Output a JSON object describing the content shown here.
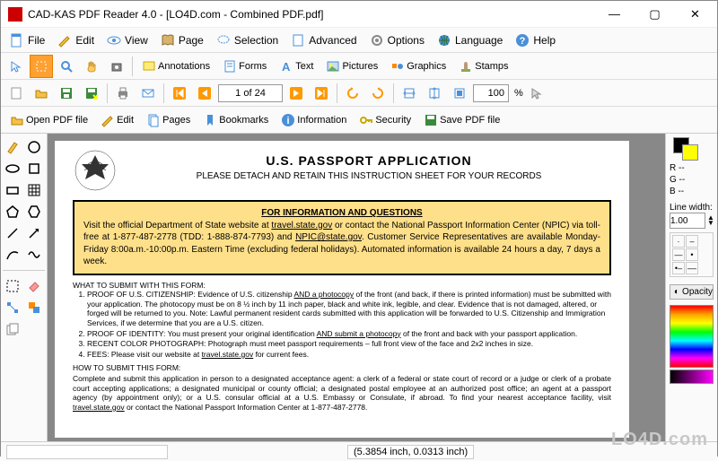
{
  "window": {
    "title": "CAD-KAS PDF Reader 4.0 - [LO4D.com - Combined PDF.pdf]",
    "min": "—",
    "max": "▢",
    "close": "✕"
  },
  "menu": {
    "file": "File",
    "edit": "Edit",
    "view": "View",
    "page": "Page",
    "selection": "Selection",
    "advanced": "Advanced",
    "options": "Options",
    "language": "Language",
    "help": "Help"
  },
  "tooltabs": {
    "annotations": "Annotations",
    "forms": "Forms",
    "text": "Text",
    "pictures": "Pictures",
    "graphics": "Graphics",
    "stamps": "Stamps"
  },
  "nav": {
    "page": "1 of 24",
    "zoom": "100",
    "pct": "%"
  },
  "actions": {
    "open": "Open PDF file",
    "edit": "Edit",
    "pages": "Pages",
    "bookmarks": "Bookmarks",
    "information": "Information",
    "security": "Security",
    "save": "Save PDF file"
  },
  "rightpanel": {
    "r": "R --",
    "g": "G --",
    "b": "B --",
    "linewidth_label": "Line width:",
    "linewidth": "1.00",
    "opacity": "Opacity"
  },
  "status": {
    "pos": "(5.3854 inch, 0.0313 inch)"
  },
  "watermark": "LO4D.com",
  "doc": {
    "h1": "U.S. PASSPORT APPLICATION",
    "h2": "PLEASE DETACH AND RETAIN THIS INSTRUCTION SHEET FOR YOUR RECORDS",
    "boxtitle": "FOR INFORMATION AND QUESTIONS",
    "boxtext1": "Visit the official Department of State website at ",
    "boxlink1": "travel.state.gov",
    "boxtext2": " or contact the National Passport Information Center (NPIC) via toll-free at 1-877-487-2778 (TDD: 1-888-874-7793) and ",
    "boxlink2": "NPIC@state.gov",
    "boxtext3": ". Customer Service Representatives are available Monday-Friday 8:00a.m.-10:00p.m. Eastern Time (excluding federal holidays). Automated information is available 24 hours a day, 7 days a week.",
    "s1title": "WHAT TO SUBMIT WITH THIS FORM:",
    "li1a": "PROOF OF U.S. CITIZENSHIP: Evidence of U.S. citizenship ",
    "li1u": "AND a photocopy",
    "li1b": " of the front (and back, if there is printed information) must be submitted with your application. The photocopy must be on 8 ½ inch by 11 inch paper, black and white ink, legible, and clear. Evidence that is not damaged, altered, or forged will be returned to you. Note: Lawful permanent resident cards submitted with this application will be forwarded to U.S. Citizenship and Immigration Services, if we determine that you are a U.S. citizen.",
    "li2a": "PROOF OF IDENTITY: You must present your original identification ",
    "li2u": "AND submit a photocopy",
    "li2b": " of the front and back with your passport application.",
    "li3": "RECENT COLOR PHOTOGRAPH: Photograph must meet passport requirements – full front view of the face and 2x2 inches in size.",
    "li4a": "FEES: Please visit our website at ",
    "li4u": "travel.state.gov",
    "li4b": " for current fees.",
    "s2title": "HOW TO SUBMIT THIS FORM:",
    "s2text1": "Complete and submit this application in person to a designated acceptance agent: a clerk of a federal or state court of record or a judge or clerk of a probate court accepting applications; a designated municipal or county official; a designated postal employee at an authorized post office; an agent at a passport agency (by appointment only); or a U.S. consular official at a U.S. Embassy or Consulate, if abroad. To find your nearest acceptance facility, visit ",
    "s2link": "travel.state.gov",
    "s2text2": " or contact the National Passport Information Center at 1-877-487-2778."
  }
}
